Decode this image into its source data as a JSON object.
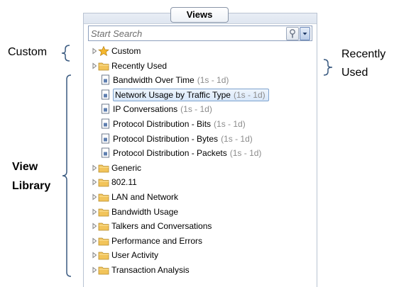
{
  "panel": {
    "title": "Views",
    "search_placeholder": "Start Search"
  },
  "tree": {
    "top_items": [
      {
        "label": "Custom",
        "icon": "star-icon"
      },
      {
        "label": "Recently Used",
        "icon": "folder-icon"
      }
    ],
    "recent_views": [
      {
        "label": "Bandwidth Over Time",
        "range": "(1s - 1d)"
      },
      {
        "label": "Network Usage by Traffic Type",
        "range": "(1s - 1d)"
      },
      {
        "label": "IP Conversations",
        "range": "(1s - 1d)"
      },
      {
        "label": "Protocol Distribution - Bits",
        "range": "(1s - 1d)"
      },
      {
        "label": "Protocol Distribution - Bytes",
        "range": "(1s - 1d)"
      },
      {
        "label": "Protocol Distribution - Packets",
        "range": "(1s - 1d)"
      }
    ],
    "library_folders": [
      {
        "label": "Generic"
      },
      {
        "label": "802.11"
      },
      {
        "label": "LAN and Network"
      },
      {
        "label": "Bandwidth Usage"
      },
      {
        "label": "Talkers and Conversations"
      },
      {
        "label": "Performance and Errors"
      },
      {
        "label": "User Activity"
      },
      {
        "label": "Transaction Analysis"
      }
    ]
  },
  "annotations": {
    "custom": "Custom",
    "recently_used_line1": "Recently",
    "recently_used_line2": "Used",
    "view_library_line1": "View",
    "view_library_line2": "Library"
  },
  "colors": {
    "folder": "#f2c45a",
    "star": "#f5b82e",
    "selection_border": "#7da2ce",
    "range_text": "#8c8c8c"
  }
}
